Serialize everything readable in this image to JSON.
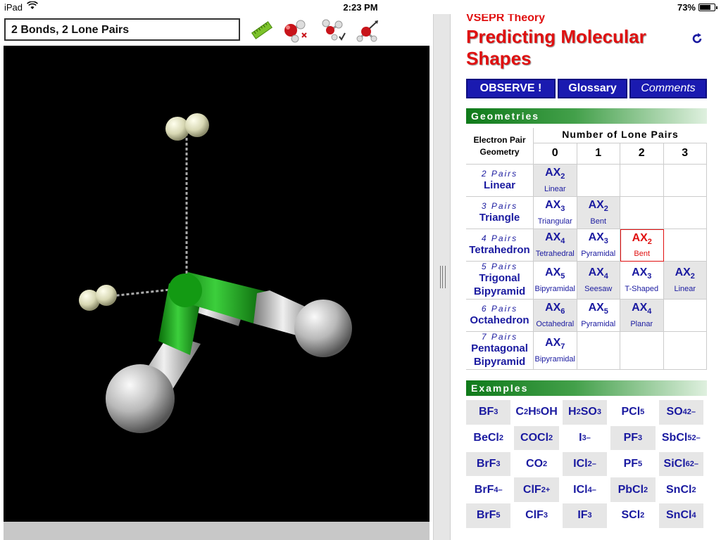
{
  "status": {
    "device": "iPad",
    "time": "2:23 PM",
    "battery": "73%",
    "battery_level": 0.73
  },
  "left": {
    "title": "2 Bonds, 2 Lone Pairs",
    "toolbar": [
      {
        "name": "ruler-icon"
      },
      {
        "name": "molecule-model-icon"
      },
      {
        "name": "molecule-check-icon"
      },
      {
        "name": "molecule-axes-icon"
      }
    ],
    "colors": {
      "central_atom": "#12a012",
      "ligand": "#c8c8c8",
      "lone_pair": "#e8e8c8",
      "background": "#000000"
    }
  },
  "right": {
    "subtitle": "VSEPR Theory",
    "title": "Predicting Molecular Shapes",
    "refresh_icon": "refresh-icon",
    "nav": {
      "observe": "OBSERVE !",
      "glossary": "Glossary",
      "comments": "Comments"
    },
    "geometries_header": "Geometries",
    "epg_label_1": "Electron Pair",
    "epg_label_2": "Geometry",
    "lone_pairs_label": "Number of Lone Pairs",
    "lone_pair_counts": [
      "0",
      "1",
      "2",
      "3"
    ],
    "rows": [
      {
        "pairs": "2 Pairs",
        "name": "Linear",
        "cells": [
          {
            "x": "2",
            "shape": "Linear"
          },
          null,
          null,
          null
        ]
      },
      {
        "pairs": "3 Pairs",
        "name": "Triangle",
        "cells": [
          {
            "x": "3",
            "shape": "Triangular"
          },
          {
            "x": "2",
            "shape": "Bent"
          },
          null,
          null
        ]
      },
      {
        "pairs": "4 Pairs",
        "name": "Tetrahedron",
        "cells": [
          {
            "x": "4",
            "shape": "Tetrahedral"
          },
          {
            "x": "3",
            "shape": "Pyramidal"
          },
          {
            "x": "2",
            "shape": "Bent",
            "selected": true
          },
          null
        ]
      },
      {
        "pairs": "5 Pairs",
        "name": "Trigonal Bipyramid",
        "cells": [
          {
            "x": "5",
            "shape": "Bipyramidal"
          },
          {
            "x": "4",
            "shape": "Seesaw"
          },
          {
            "x": "3",
            "shape": "T-Shaped"
          },
          {
            "x": "2",
            "shape": "Linear"
          }
        ]
      },
      {
        "pairs": "6 Pairs",
        "name": "Octahedron",
        "cells": [
          {
            "x": "6",
            "shape": "Octahedral"
          },
          {
            "x": "5",
            "shape": "Pyramidal"
          },
          {
            "x": "4",
            "shape": "Planar"
          },
          null
        ]
      },
      {
        "pairs": "7 Pairs",
        "name": "Pentagonal Bipyramid",
        "cells": [
          {
            "x": "7",
            "shape": "Bipyramidal"
          },
          null,
          null,
          null
        ]
      }
    ],
    "examples_header": "Examples",
    "examples": [
      [
        "BF<sub>3</sub>",
        "C<sub>2</sub>H<sub>5</sub>OH",
        "H<sub>2</sub>SO<sub>3</sub>",
        "PCl<sub>5</sub>",
        "SO<sub>4</sub><sup>2–</sup>"
      ],
      [
        "BeCl<sub>2</sub>",
        "COCl<sub>2</sub>",
        "I<sub>3</sub><sup>–</sup>",
        "PF<sub>3</sub>",
        "SbCl<sub>5</sub><sup>2–</sup>"
      ],
      [
        "BrF<sub>3</sub>",
        "CO<sub>2</sub>",
        "ICl<sub>2</sub><sup>–</sup>",
        "PF<sub>5</sub>",
        "SiCl<sub>6</sub><sup>2–</sup>"
      ],
      [
        "BrF<sub>4</sub><sup>–</sup>",
        "ClF<sub>2</sub><sup>+</sup>",
        "ICl<sub>4</sub><sup>–</sup>",
        "PbCl<sub>2</sub>",
        "SnCl<sub>2</sub>"
      ],
      [
        "BrF<sub>5</sub>",
        "ClF<sub>3</sub>",
        "IF<sub>3</sub>",
        "SCl<sub>2</sub>",
        "SnCl<sub>4</sub>"
      ]
    ]
  }
}
